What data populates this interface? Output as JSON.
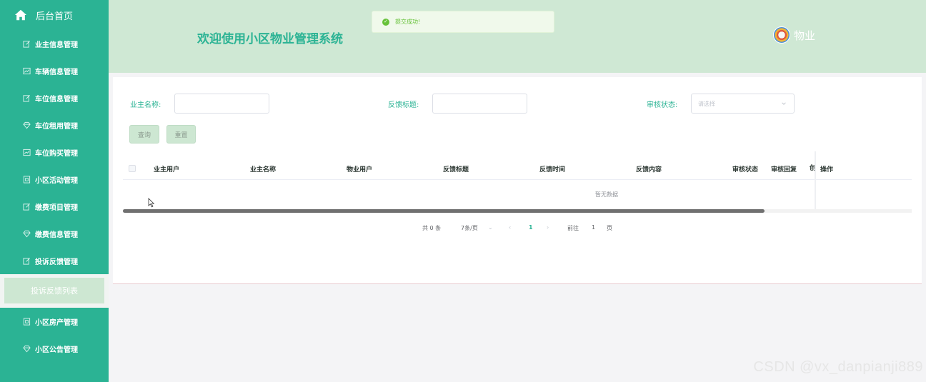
{
  "sidebar": {
    "home_label": "后台首页",
    "items": [
      {
        "label": "业主信息管理",
        "icon": "edit-icon"
      },
      {
        "label": "车辆信息管理",
        "icon": "chart-icon"
      },
      {
        "label": "车位信息管理",
        "icon": "edit-icon"
      },
      {
        "label": "车位租用管理",
        "icon": "diamond-icon"
      },
      {
        "label": "车位购买管理",
        "icon": "chart-icon"
      },
      {
        "label": "小区活动管理",
        "icon": "document-icon"
      },
      {
        "label": "缴费项目管理",
        "icon": "edit-icon"
      },
      {
        "label": "缴费信息管理",
        "icon": "diamond-icon"
      },
      {
        "label": "投诉反馈管理",
        "icon": "edit-icon"
      }
    ],
    "active_sub": "投诉反馈列表",
    "items_after": [
      {
        "label": "小区房产管理",
        "icon": "document-icon"
      },
      {
        "label": "小区公告管理",
        "icon": "diamond-icon"
      }
    ]
  },
  "header": {
    "title": "欢迎使用小区物业管理系统",
    "user": "物业"
  },
  "toast": {
    "message": "提交成功!"
  },
  "filters": {
    "owner_name_label": "业主名称:",
    "feedback_title_label": "反馈标题:",
    "status_label": "审核状态:",
    "status_placeholder": "请选择",
    "query_button": "查询",
    "reset_button": "重置"
  },
  "table": {
    "columns": [
      "业主用户",
      "业主名称",
      "物业用户",
      "反馈标题",
      "反馈时间",
      "反馈内容",
      "审核状态",
      "审核回复",
      "创",
      "操作"
    ],
    "empty_text": "暂无数据"
  },
  "pagination": {
    "total": "共 0 条",
    "page_size": "7条/页",
    "current_page": "1",
    "goto_label": "前往",
    "goto_value": "1",
    "page_unit": "页"
  },
  "watermark": "CSDN @vx_danpianji889",
  "colors": {
    "sidebar": "#2bb394",
    "header": "#cfe8d4",
    "accent": "#2bb394",
    "success": "#67c23a"
  }
}
